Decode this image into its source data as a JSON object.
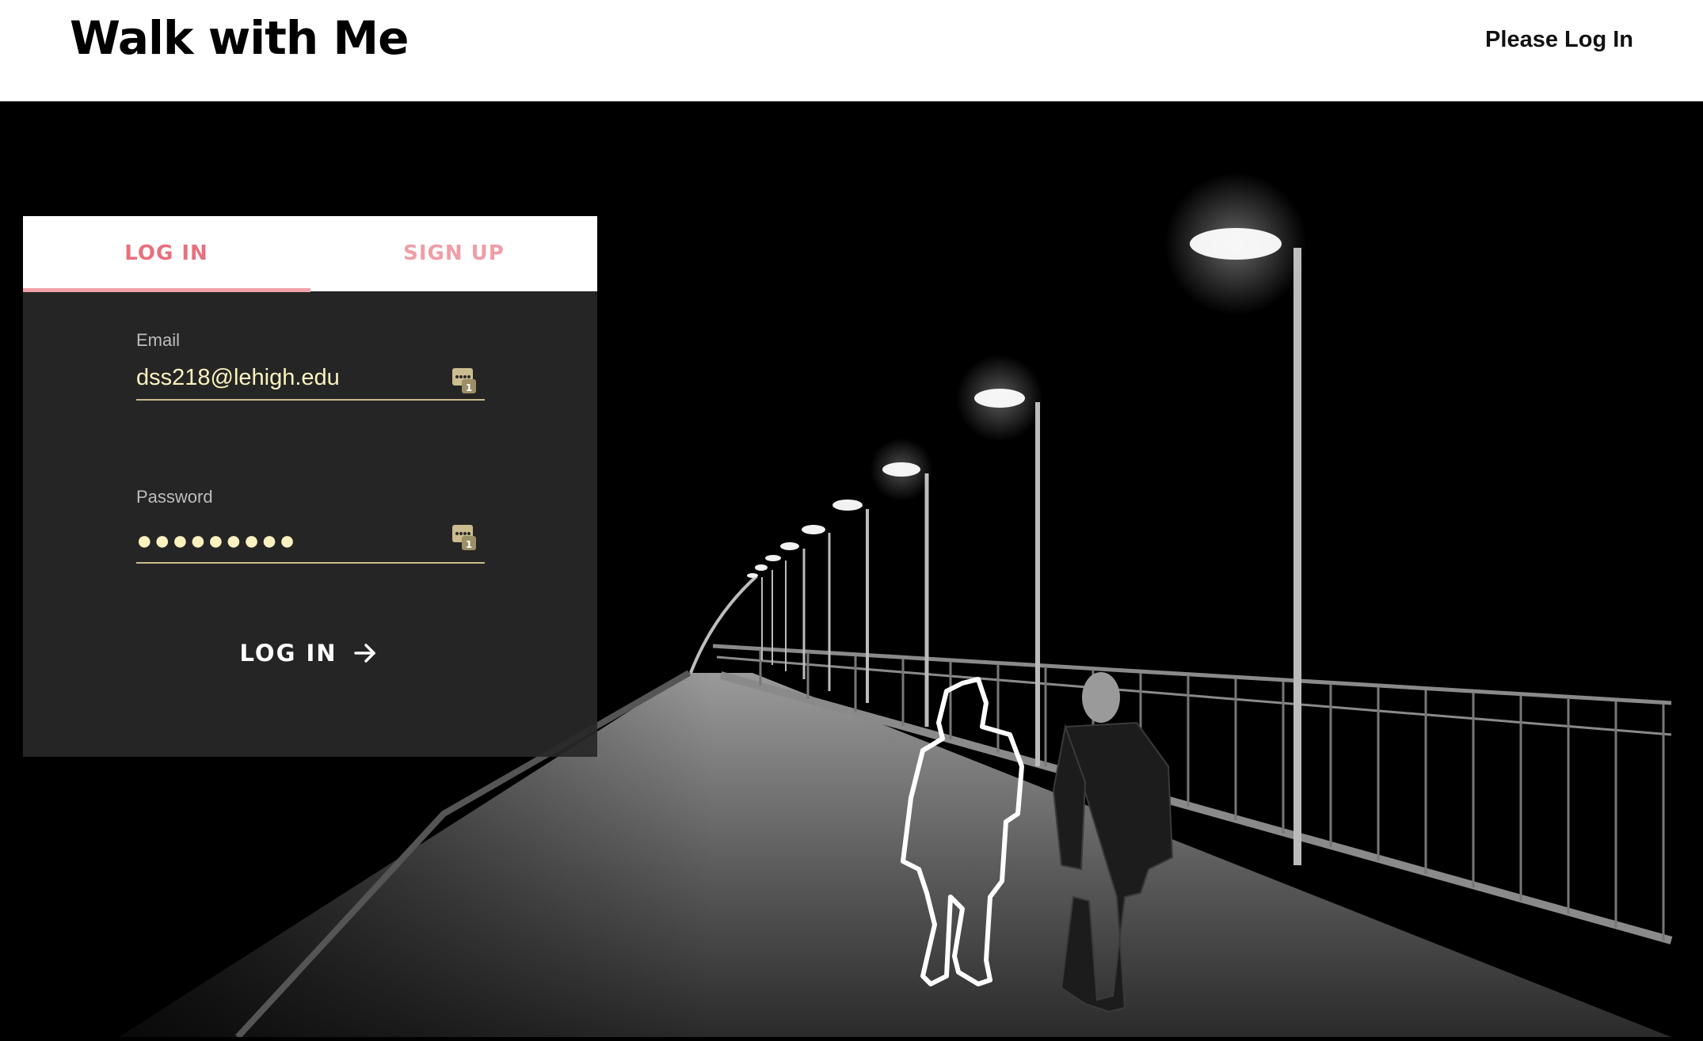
{
  "header": {
    "logo": "Walk with Me",
    "status": "Please Log In"
  },
  "auth": {
    "tabs": [
      {
        "label": "LOG IN",
        "active": true
      },
      {
        "label": "SIGN UP",
        "active": false
      }
    ],
    "email": {
      "label": "Email",
      "value": "dss218@lehigh.edu",
      "icon": "password-manager-icon"
    },
    "password": {
      "label": "Password",
      "masked_value": "●●●●●●●●●",
      "icon": "password-manager-icon"
    },
    "submit": {
      "label": "LOG IN",
      "icon": "arrow-right-icon"
    }
  },
  "colors": {
    "accent": "#e8707c",
    "input_text": "#fbf2c0",
    "underline": "#c9b98c",
    "panel_bg": "#282828"
  }
}
